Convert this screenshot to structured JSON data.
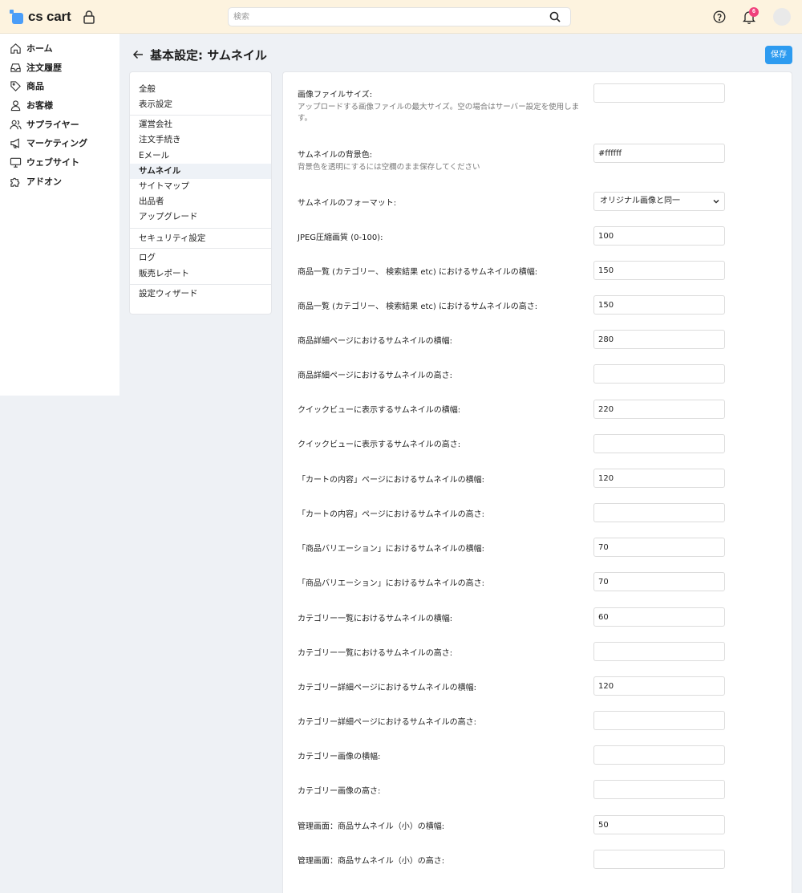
{
  "header": {
    "logo_text": "cs cart",
    "search_placeholder": "検索",
    "notification_count": "6"
  },
  "sidebar": {
    "items": [
      {
        "label": "ホーム",
        "icon": "home-icon"
      },
      {
        "label": "注文履歴",
        "icon": "inbox-icon"
      },
      {
        "label": "商品",
        "icon": "tag-icon"
      },
      {
        "label": "お客様",
        "icon": "user-icon"
      },
      {
        "label": "サプライヤー",
        "icon": "users-icon"
      },
      {
        "label": "マーケティング",
        "icon": "megaphone-icon"
      },
      {
        "label": "ウェブサイト",
        "icon": "monitor-icon"
      },
      {
        "label": "アドオン",
        "icon": "puzzle-icon"
      }
    ]
  },
  "page": {
    "title": "基本設定: サムネイル",
    "save_label": "保存"
  },
  "submenu": {
    "items": [
      "全般",
      "表示設定",
      "運営会社",
      "注文手続き",
      "Eメール",
      "サムネイル",
      "サイトマップ",
      "出品者",
      "アップグレード",
      "セキュリティ設定",
      "ログ",
      "販売レポート",
      "設定ウィザード"
    ],
    "active": "サムネイル"
  },
  "settings": {
    "fields": [
      {
        "label": "画像ファイルサイズ:",
        "help": "アップロードする画像ファイルの最大サイズ。空の場合はサーバー設定を使用します。",
        "value": ""
      },
      {
        "label": "サムネイルの背景色:",
        "help": "背景色を透明にするには空欄のまま保存してください",
        "value": "#ffffff"
      },
      {
        "label": "サムネイルのフォーマット:",
        "value": "オリジナル画像と同一",
        "type": "select"
      },
      {
        "label": "JPEG圧縮画質 (0-100):",
        "value": "100"
      },
      {
        "label": "商品一覧 (カテゴリー、 検索結果 etc) におけるサムネイルの横幅:",
        "value": "150"
      },
      {
        "label": "商品一覧 (カテゴリー、 検索結果 etc) におけるサムネイルの高さ:",
        "value": "150"
      },
      {
        "label": "商品詳細ページにおけるサムネイルの横幅:",
        "value": "280"
      },
      {
        "label": "商品詳細ページにおけるサムネイルの高さ:",
        "value": ""
      },
      {
        "label": "クイックビューに表示するサムネイルの横幅:",
        "value": "220"
      },
      {
        "label": "クイックビューに表示するサムネイルの高さ:",
        "value": ""
      },
      {
        "label": "「カートの内容」ページにおけるサムネイルの横幅:",
        "value": "120"
      },
      {
        "label": "「カートの内容」ページにおけるサムネイルの高さ:",
        "value": ""
      },
      {
        "label": "「商品バリエーション」におけるサムネイルの横幅:",
        "value": "70"
      },
      {
        "label": "「商品バリエーション」におけるサムネイルの高さ:",
        "value": "70"
      },
      {
        "label": "カテゴリー一覧におけるサムネイルの横幅:",
        "value": "60"
      },
      {
        "label": "カテゴリー一覧におけるサムネイルの高さ:",
        "value": ""
      },
      {
        "label": "カテゴリー詳細ページにおけるサムネイルの横幅:",
        "value": "120"
      },
      {
        "label": "カテゴリー詳細ページにおけるサムネイルの高さ:",
        "value": ""
      },
      {
        "label": "カテゴリー画像の横幅:",
        "value": ""
      },
      {
        "label": "カテゴリー画像の高さ:",
        "value": ""
      },
      {
        "label": "管理画面：商品サムネイル（小）の横幅:",
        "value": "50"
      },
      {
        "label": "管理画面：商品サムネイル（小）の高さ:",
        "value": ""
      }
    ]
  }
}
